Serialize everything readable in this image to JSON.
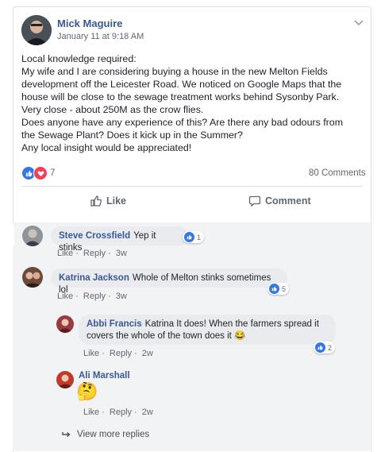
{
  "post": {
    "author": "Mick Maguire",
    "timestamp": "January 11 at 9:18 AM",
    "lines": [
      "Local knowledge required:",
      "My wife and I are considering buying a house in the new Melton Fields",
      "development off the Leicester Road. We noticed on Google Maps that the",
      "house will be close to the sewage treatment works behind Sysonby Park.",
      "Very close - about 250M as the crow flies.",
      "Does anyone have any experience of this? Are there any bad odours from",
      "the Sewage Plant? Does it kick up in the Summer?",
      "Any local insight would be appreciated!"
    ],
    "reaction_count": "7",
    "comments_count": "80 Comments"
  },
  "actions": {
    "like": "Like",
    "comment": "Comment"
  },
  "comments": [
    {
      "name": "Steve Crossfield",
      "text": "Yep it stinks",
      "likes": "1",
      "like": "Like",
      "reply": "Reply",
      "age": "3w"
    },
    {
      "name": "Katrina Jackson",
      "text": "Whole of Melton stinks sometimes lol",
      "likes": "5",
      "like": "Like",
      "reply": "Reply",
      "age": "3w"
    }
  ],
  "replies": [
    {
      "name": "Abbi Francis",
      "text_line1": "Katrina It does! When the farmers spread it",
      "text_line2": "covers the whole of the town does it",
      "emoji": "😂",
      "likes": "2",
      "like": "Like",
      "reply": "Reply",
      "age": "2w"
    },
    {
      "name": "Ali Marshall",
      "emoji": "🤔",
      "like": "Like",
      "reply": "Reply",
      "age": "2w"
    }
  ],
  "view_more": "View more replies",
  "colors": {
    "link": "#385898",
    "like_blue": "#3578e5",
    "love_red": "#f33e58"
  }
}
